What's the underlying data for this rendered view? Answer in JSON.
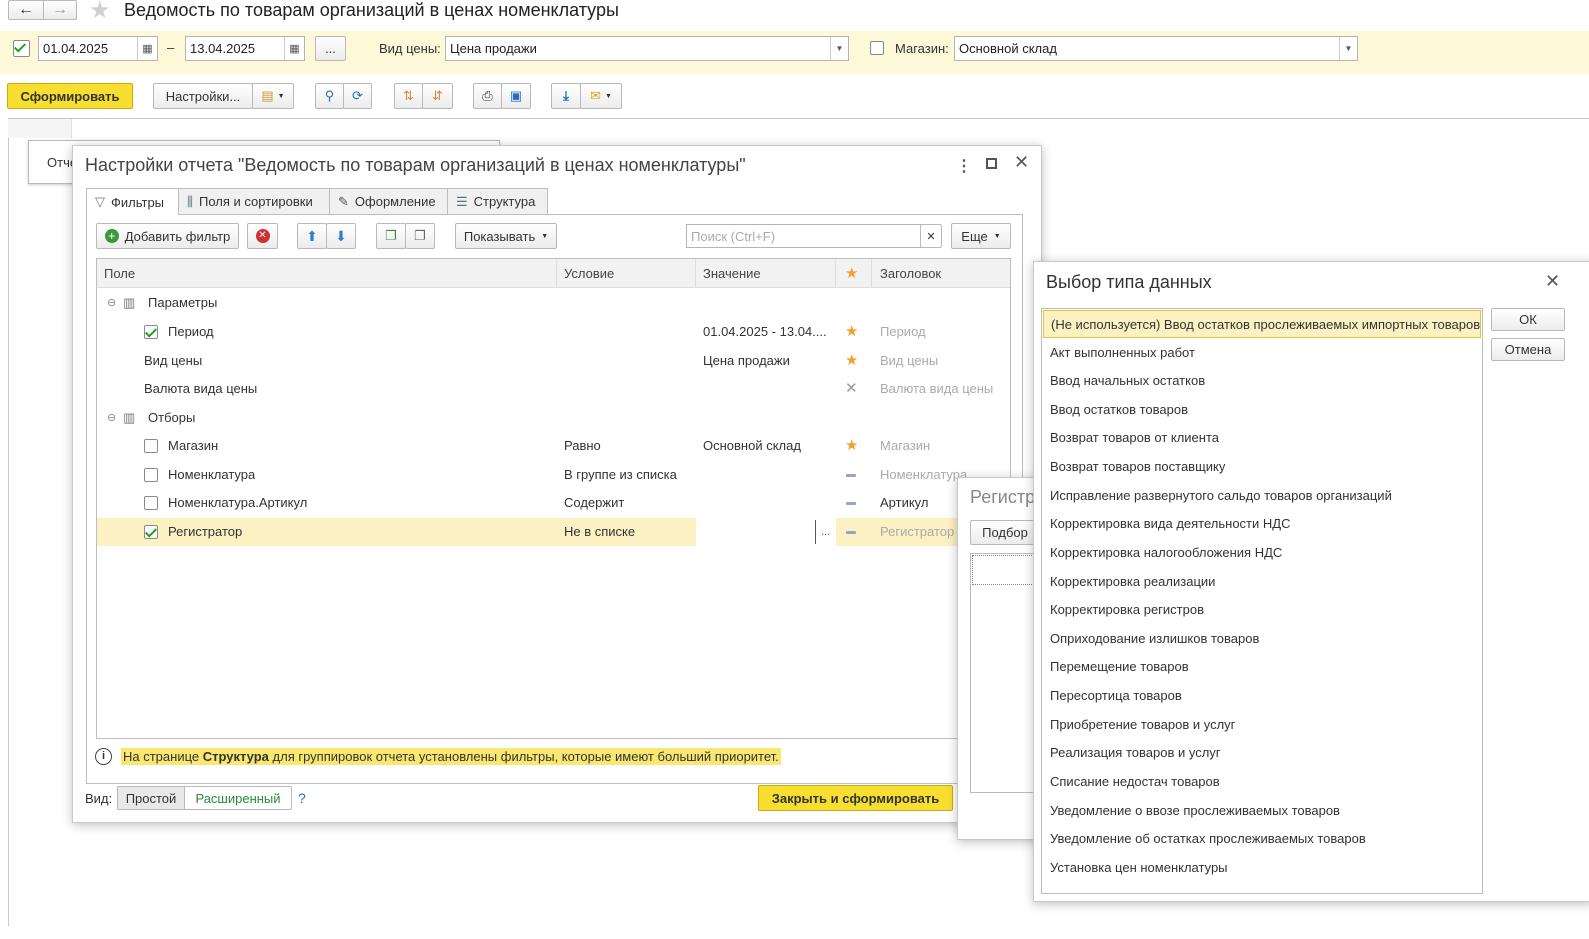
{
  "window": {
    "title": "Ведомость по товарам организаций в ценах номенклатуры"
  },
  "params": {
    "date_from": "01.04.2025",
    "date_sep": "–",
    "date_to": "13.04.2025",
    "more_btn": "...",
    "price_type_label": "Вид цены:",
    "price_type_value": "Цена продажи",
    "store_label": "Магазин:",
    "store_value": "Основной склад"
  },
  "toolbar": {
    "generate_label": "Сформировать",
    "settings_label": "Настройки..."
  },
  "bg_report_tab": "Отче",
  "settings_dialog": {
    "title": "Настройки отчета \"Ведомость по товарам организаций в ценах номенклатуры\"",
    "tabs": [
      "Фильтры",
      "Поля и сортировки",
      "Оформление",
      "Структура"
    ],
    "add_filter": "Добавить фильтр",
    "show_label": "Показывать",
    "search_placeholder": "Поиск (Ctrl+F)",
    "more_label": "Еще",
    "columns": [
      "Поле",
      "Условие",
      "Значение",
      "Заголовок"
    ],
    "rows": [
      {
        "field": "Параметры",
        "condition": "",
        "value": "",
        "title": ""
      },
      {
        "field": "Период",
        "condition": "",
        "value": "01.04.2025 - 13.04....",
        "title": "Период"
      },
      {
        "field": "Вид цены",
        "condition": "",
        "value": "Цена продажи",
        "title": "Вид цены"
      },
      {
        "field": "Валюта вида цены",
        "condition": "",
        "value": "",
        "title": "Валюта вида цены"
      },
      {
        "field": "Отборы",
        "condition": "",
        "value": "",
        "title": ""
      },
      {
        "field": "Магазин",
        "condition": "Равно",
        "value": "Основной склад",
        "title": "Магазин"
      },
      {
        "field": "Номенклатура",
        "condition": "В группе из списка",
        "value": "",
        "title": "Номенклатура"
      },
      {
        "field": "Номенклатура.Артикул",
        "condition": "Содержит",
        "value": "",
        "title": "Артикул"
      },
      {
        "field": "Регистратор",
        "condition": "Не в списке",
        "value": "",
        "title": "Регистратор"
      }
    ],
    "value_ellipsis": "...",
    "info_pre": "На странице ",
    "info_bold": "Структура",
    "info_post": " для группировок отчета установлены фильтры, которые имеют больший приоритет.",
    "view_label": "Вид:",
    "view_simple": "Простой",
    "view_extended": "Расширенный",
    "help": "?",
    "close_generate": "Закрыть и сформировать"
  },
  "registrar_dialog": {
    "title": "Регистр",
    "pick_btn": "Подбор"
  },
  "type_dialog": {
    "title": "Выбор типа данных",
    "ok": "ОК",
    "cancel": "Отмена",
    "items": [
      "(Не используется) Ввод остатков прослеживаемых импортных товаров",
      "Акт выполненных работ",
      "Ввод начальных остатков",
      "Ввод остатков товаров",
      "Возврат товаров от клиента",
      "Возврат товаров поставщику",
      "Исправление развернутого сальдо товаров организаций",
      "Корректировка вида деятельности НДС",
      "Корректировка налогообложения НДС",
      "Корректировка реализации",
      "Корректировка регистров",
      "Оприходование излишков товаров",
      "Перемещение товаров",
      "Пересортица товаров",
      "Приобретение товаров и услуг",
      "Реализация товаров и услуг",
      "Списание недостач товаров",
      "Уведомление о ввозе прослеживаемых товаров",
      "Уведомление об остатках прослеживаемых товаров",
      "Установка цен номенклатуры"
    ]
  },
  "colors": {
    "accent_yellow": "#f8de2e",
    "highlight_row": "#fcf1c2",
    "param_bar": "#fdf8d7"
  }
}
